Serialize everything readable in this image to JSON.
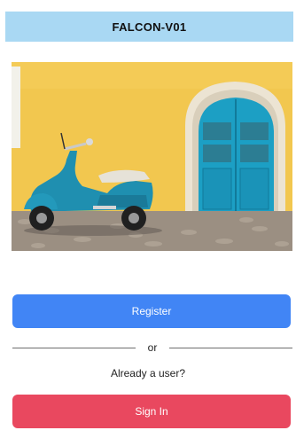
{
  "header": {
    "title": "FALCON-V01"
  },
  "hero": {
    "image_alt_icon": "hero-image-scooter"
  },
  "auth": {
    "register_label": "Register",
    "divider_text": "or",
    "already_user_text": "Already a user?",
    "signin_label": "Sign In"
  },
  "colors": {
    "header_bg": "#a9d8f3",
    "register_bg": "#4185f5",
    "signin_bg": "#e9485f"
  }
}
